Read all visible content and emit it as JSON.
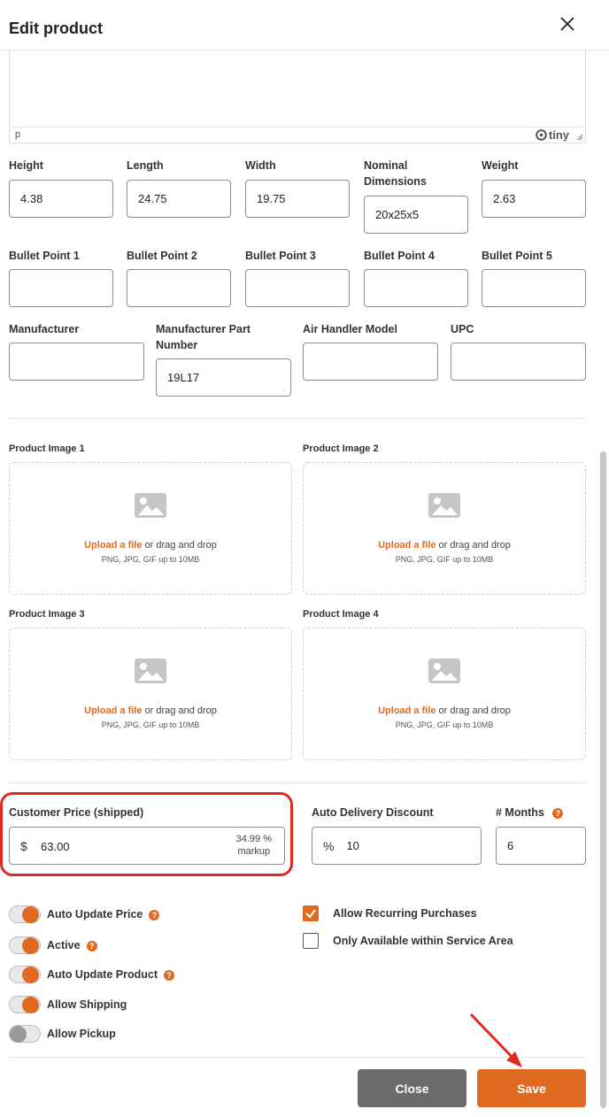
{
  "header": {
    "title": "Edit product"
  },
  "editor": {
    "path": "p",
    "brand": "tiny"
  },
  "dimensions": [
    {
      "label": "Height",
      "value": "4.38"
    },
    {
      "label": "Length",
      "value": "24.75"
    },
    {
      "label": "Width",
      "value": "19.75"
    },
    {
      "label": "Nominal Dimensions",
      "value": "20x25x5"
    },
    {
      "label": "Weight",
      "value": "2.63"
    }
  ],
  "bullets": [
    {
      "label": "Bullet Point 1",
      "value": ""
    },
    {
      "label": "Bullet Point 2",
      "value": ""
    },
    {
      "label": "Bullet Point 3",
      "value": ""
    },
    {
      "label": "Bullet Point 4",
      "value": ""
    },
    {
      "label": "Bullet Point 5",
      "value": ""
    }
  ],
  "manufacturing": [
    {
      "label": "Manufacturer",
      "value": ""
    },
    {
      "label": "Manufacturer Part Number",
      "value": "19L17"
    },
    {
      "label": "Air Handler Model",
      "value": ""
    },
    {
      "label": "UPC",
      "value": ""
    }
  ],
  "images": [
    {
      "label": "Product Image 1"
    },
    {
      "label": "Product Image 2"
    },
    {
      "label": "Product Image 3"
    },
    {
      "label": "Product Image 4"
    }
  ],
  "upload": {
    "link": "Upload a file",
    "text": " or drag and drop",
    "hint": "PNG, JPG, GIF up to 10MB"
  },
  "pricing": {
    "customer_price_label": "Customer Price (shipped)",
    "currency": "$",
    "customer_price": "63.00",
    "markup_pct": "34.99 %",
    "markup_word": "markup",
    "auto_delivery_label": "Auto Delivery Discount",
    "percent_symbol": "%",
    "auto_delivery": "10",
    "months_label": "# Months",
    "months": "6"
  },
  "toggles": [
    {
      "label": "Auto Update Price",
      "on": true,
      "help": true
    },
    {
      "label": "Active",
      "on": true,
      "help": true
    },
    {
      "label": "Auto Update Product",
      "on": true,
      "help": true
    },
    {
      "label": "Allow Shipping",
      "on": true,
      "help": false
    },
    {
      "label": "Allow Pickup",
      "on": false,
      "help": false
    }
  ],
  "checkboxes": [
    {
      "label": "Allow Recurring Purchases",
      "checked": true
    },
    {
      "label": "Only Available within Service Area",
      "checked": false
    }
  ],
  "help_glyph": "?",
  "footer": {
    "close_label": "Close",
    "save_label": "Save"
  },
  "colors": {
    "accent": "#e06a22",
    "highlight": "#e12a1f",
    "close_button": "#6b6b6b"
  }
}
